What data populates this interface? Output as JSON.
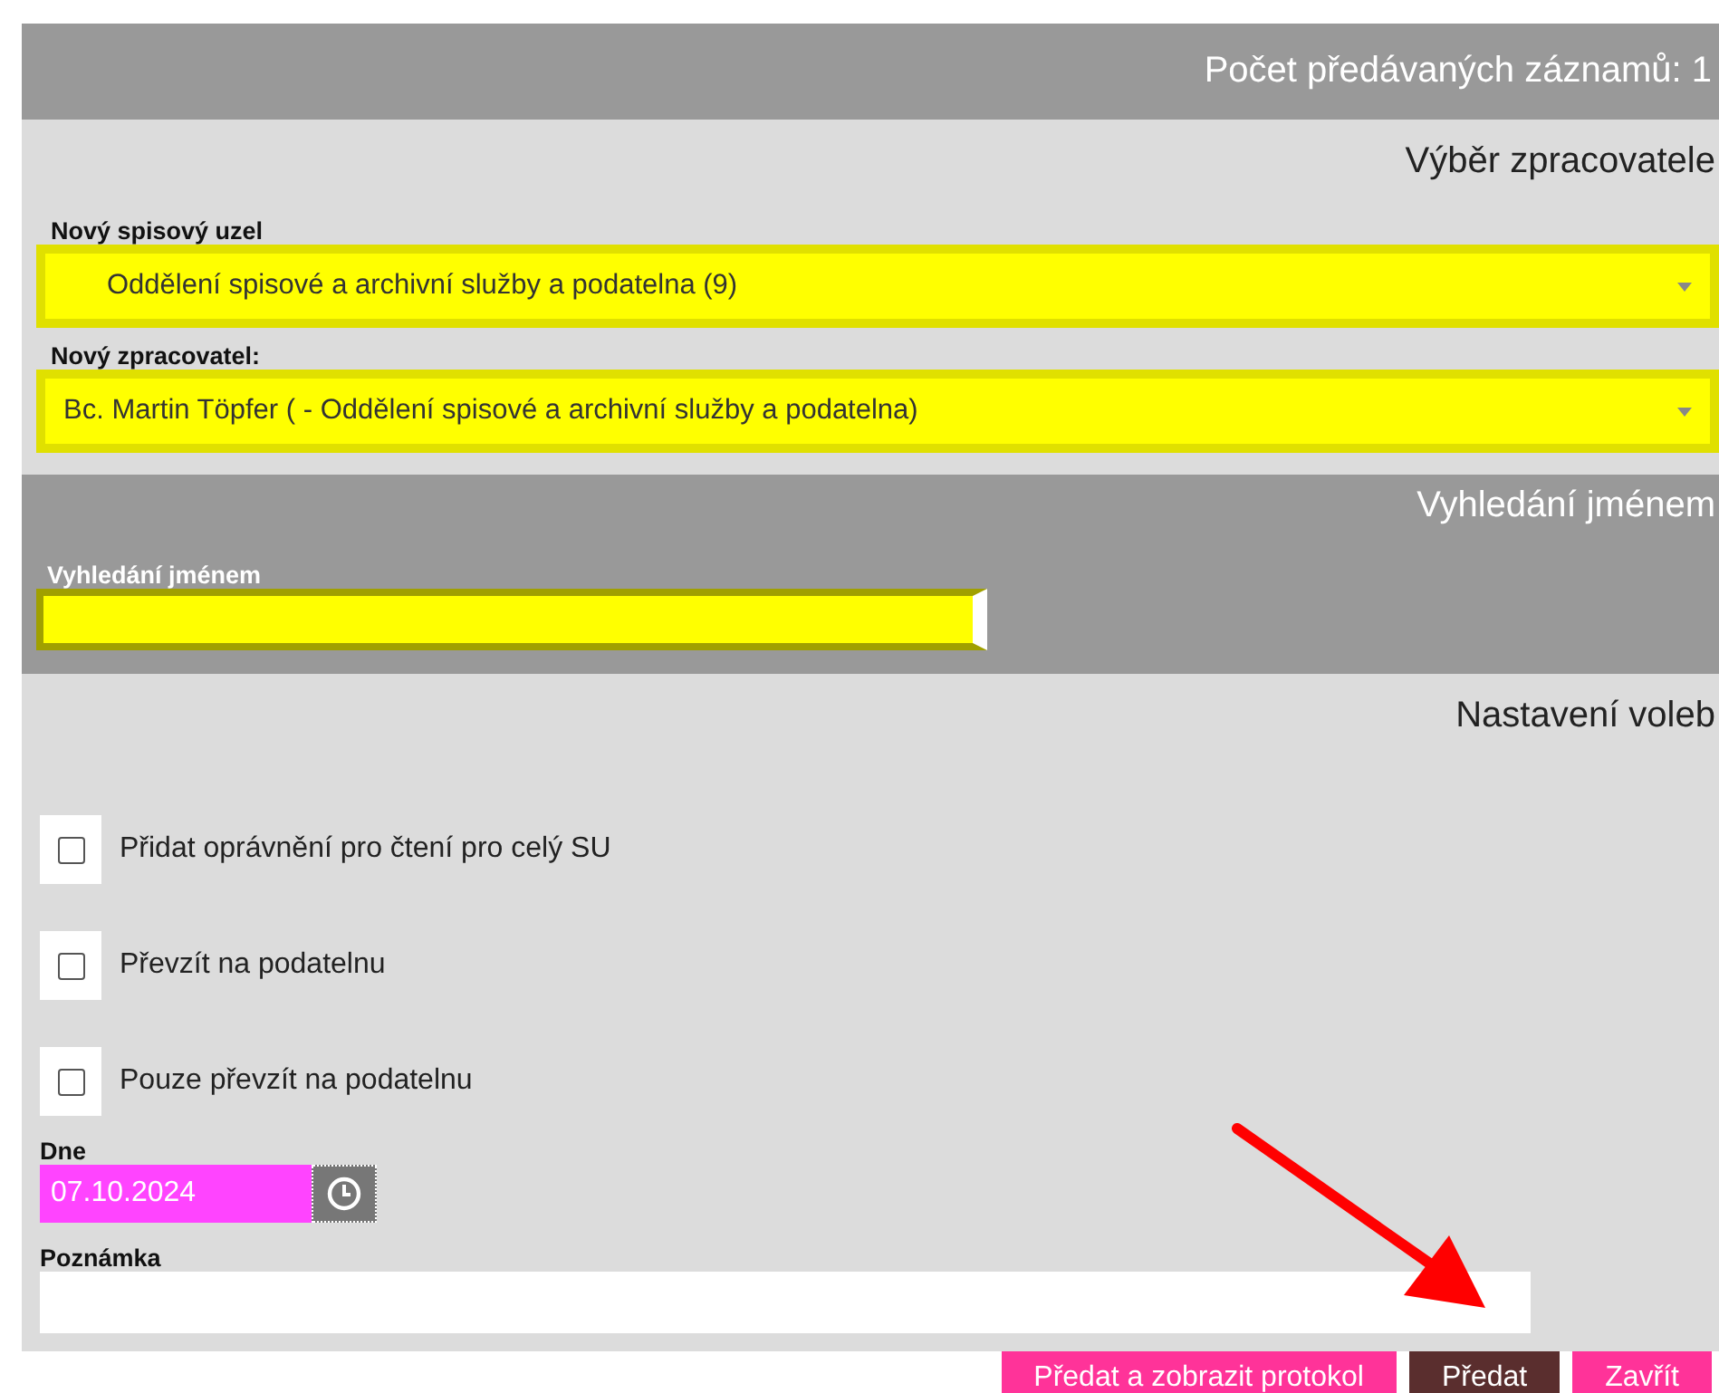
{
  "header": {
    "count_label": "Počet předávaných záznamů: 1"
  },
  "selection": {
    "title": "Výběr zpracovatele",
    "fields": [
      {
        "label": "Nový spisový uzel",
        "value": "Oddělení spisové a archivní služby a podatelna (9)",
        "indented": true
      },
      {
        "label": "Nový zpracovatel:",
        "value": "Bc. Martin Töpfer ( - Oddělení spisové a archivní služby a podatelna)",
        "indented": false
      }
    ]
  },
  "search": {
    "title": "Vyhledání jménem",
    "label": "Vyhledání jménem"
  },
  "options": {
    "title": "Nastavení voleb",
    "checkboxes": [
      {
        "label": "Přidat oprávnění pro čtení pro celý SU",
        "checked": false
      },
      {
        "label": "Převzít na podatelnu",
        "checked": false
      },
      {
        "label": "Pouze převzít na podatelnu",
        "checked": false
      }
    ]
  },
  "date": {
    "label": "Dne",
    "value": "07.10.2024"
  },
  "note": {
    "label": "Poznámka"
  },
  "buttons": [
    {
      "label": "Předat a zobrazit protokol",
      "kind": "secondary"
    },
    {
      "label": "Předat",
      "kind": "primary"
    },
    {
      "label": "Zavřít",
      "kind": "secondary"
    }
  ]
}
